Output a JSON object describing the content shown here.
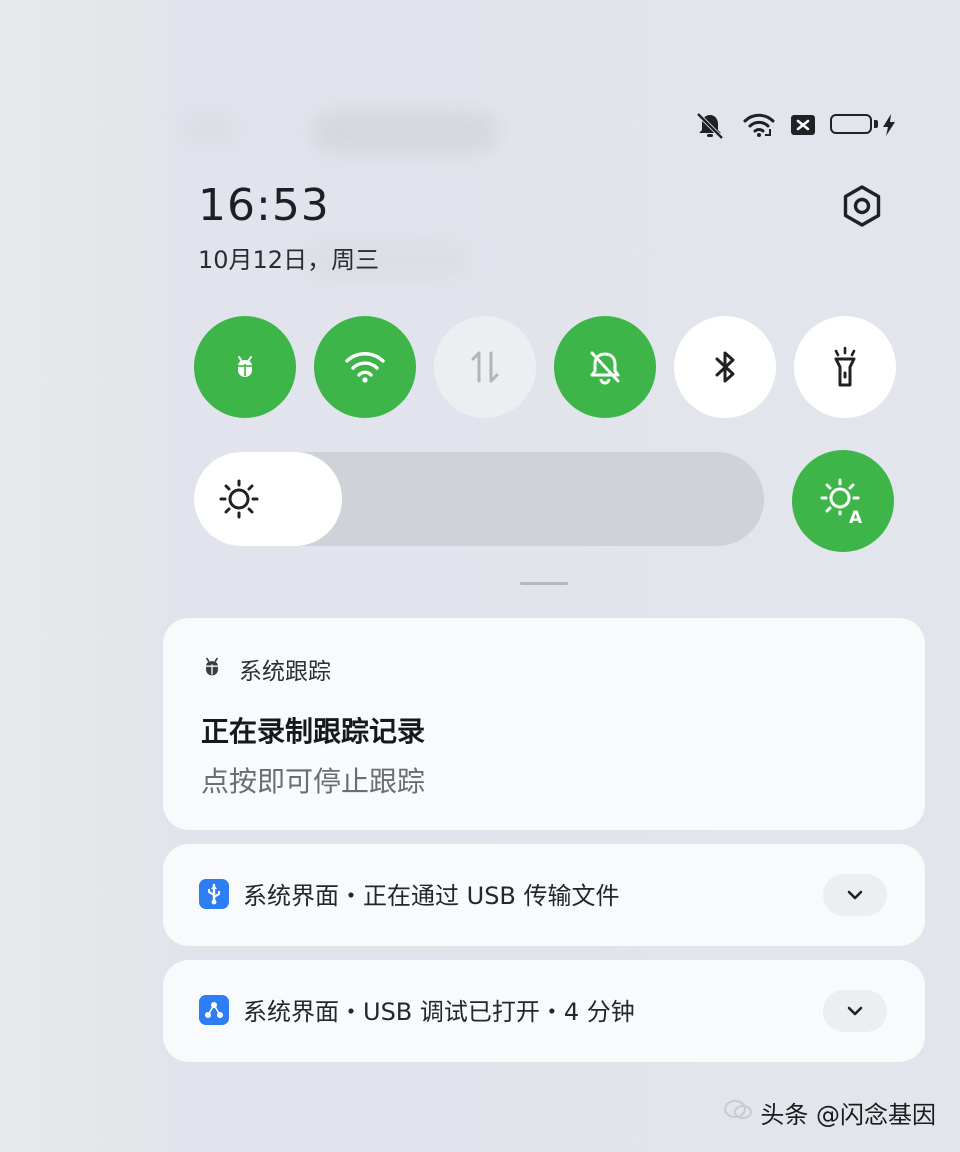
{
  "status_bar": {
    "icons": [
      "bell-off-icon",
      "wifi-icon",
      "no-sim-icon",
      "battery-icon",
      "charging-icon"
    ],
    "battery_color": "#f5c13a"
  },
  "header": {
    "time": "16:53",
    "date": "10月12日，周三"
  },
  "quick_settings": {
    "toggles": [
      {
        "icon": "bug-icon",
        "state": "on"
      },
      {
        "icon": "wifi-icon",
        "state": "on"
      },
      {
        "icon": "mobile-data-icon",
        "state": "disabled"
      },
      {
        "icon": "bell-off-icon",
        "state": "on"
      },
      {
        "icon": "bluetooth-icon",
        "state": "off"
      },
      {
        "icon": "flashlight-icon",
        "state": "off"
      }
    ],
    "accent_color": "#3db548",
    "brightness_level": 0.26,
    "auto_brightness": "on"
  },
  "notifications": {
    "trace": {
      "app": "系统跟踪",
      "title": "正在录制跟踪记录",
      "body": "点按即可停止跟踪"
    },
    "usb_transfer": {
      "label": "系统界面・正在通过 USB 传输文件"
    },
    "usb_debug": {
      "label": "系统界面・USB 调试已打开・4 分钟"
    }
  },
  "watermark": {
    "text": "头条 @闪念基因"
  }
}
